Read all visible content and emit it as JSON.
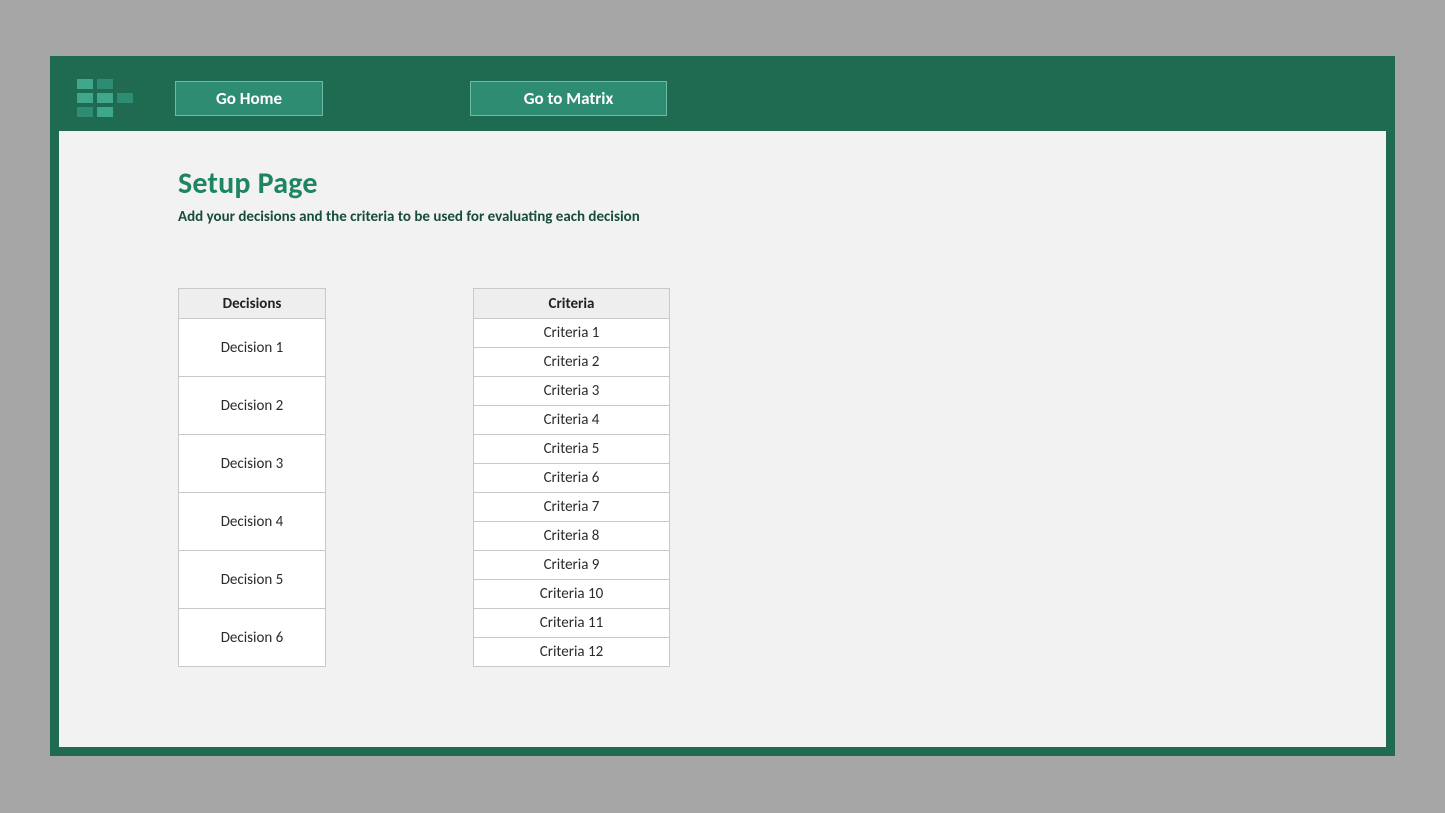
{
  "nav": {
    "home_label": "Go Home",
    "matrix_label": "Go to Matrix"
  },
  "page": {
    "title": "Setup Page",
    "subtitle": "Add your decisions and the criteria to be used for evaluating each decision"
  },
  "decisions": {
    "header": "Decisions",
    "rows": [
      "Decision 1",
      "Decision 2",
      "Decision 3",
      "Decision 4",
      "Decision 5",
      "Decision 6"
    ]
  },
  "criteria": {
    "header": "Criteria",
    "rows": [
      "Criteria 1",
      "Criteria 2",
      "Criteria 3",
      "Criteria 4",
      "Criteria 5",
      "Criteria 6",
      "Criteria 7",
      "Criteria 8",
      "Criteria 9",
      "Criteria 10",
      "Criteria 11",
      "Criteria 12"
    ]
  }
}
